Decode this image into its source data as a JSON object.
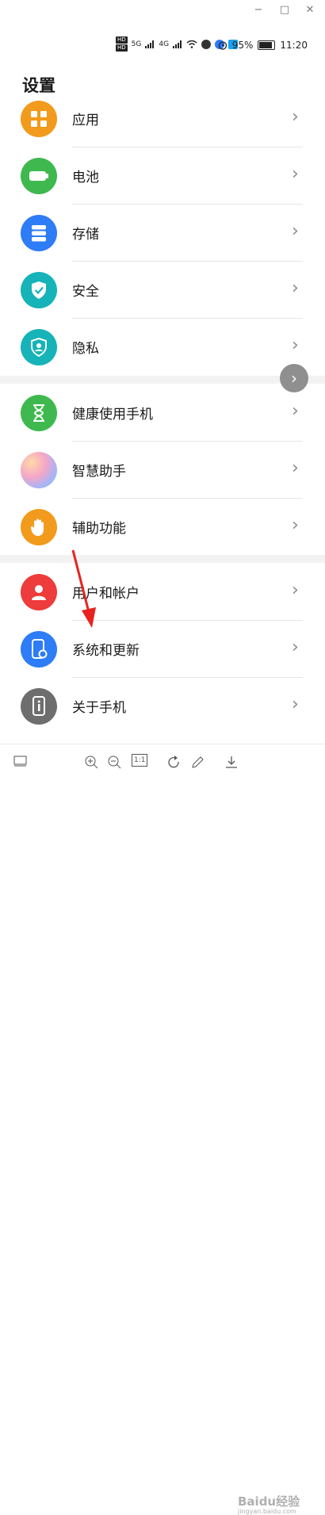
{
  "window_controls": {
    "minimize": "−",
    "maximize": "□",
    "close": "✕"
  },
  "status_bar": {
    "network_5g": "5G",
    "network_4g": "4G",
    "battery_percent": "95%",
    "time": "11:20"
  },
  "page": {
    "title": "设置"
  },
  "settings_items": [
    {
      "label": "应用",
      "icon": "apps-grid-icon",
      "color": "#F29A1B"
    },
    {
      "label": "电池",
      "icon": "battery-icon",
      "color": "#3FB94F"
    },
    {
      "label": "存储",
      "icon": "storage-icon",
      "color": "#2E7CF6"
    },
    {
      "label": "安全",
      "icon": "shield-check-icon",
      "color": "#16B3B8"
    },
    {
      "label": "隐私",
      "icon": "privacy-shield-icon",
      "color": "#16B3B8"
    },
    {
      "label": "健康使用手机",
      "icon": "hourglass-icon",
      "color": "#3FB94F"
    },
    {
      "label": "智慧助手",
      "icon": "assistant-icon",
      "color": "#C792EA"
    },
    {
      "label": "辅助功能",
      "icon": "hand-icon",
      "color": "#F29A1B"
    },
    {
      "label": "用户和帐户",
      "icon": "user-icon",
      "color": "#EE3B3B"
    },
    {
      "label": "系统和更新",
      "icon": "system-update-icon",
      "color": "#2E7CF6"
    },
    {
      "label": "关于手机",
      "icon": "about-phone-icon",
      "color": "#6E6E6E"
    }
  ],
  "chevron": "›",
  "floating_button": "›",
  "toolbar": {
    "one_to_one": "1:1"
  },
  "watermark": {
    "main": "Baidu经验",
    "sub": "jingyan.baidu.com"
  }
}
